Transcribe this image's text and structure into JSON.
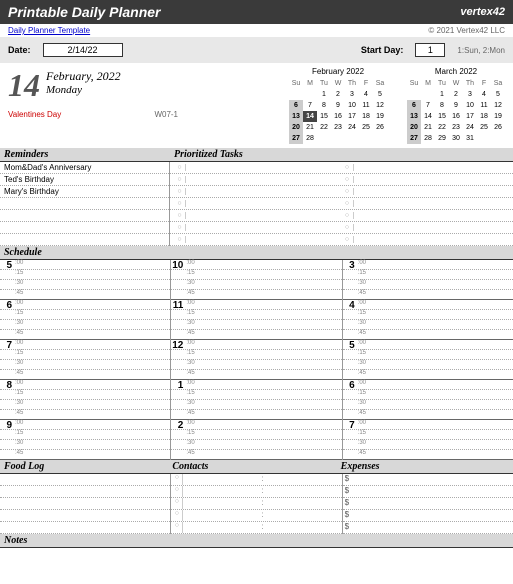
{
  "header": {
    "title": "Printable Daily Planner",
    "brand": "vertex42"
  },
  "subheader": {
    "link": "Daily Planner Template",
    "copyright": "© 2021 Vertex42 LLC"
  },
  "controls": {
    "date_label": "Date:",
    "date_value": "2/14/22",
    "startday_label": "Start Day:",
    "startday_value": "1",
    "startday_hint": "1:Sun, 2:Mon"
  },
  "day": {
    "num": "14",
    "month_year": "February, 2022",
    "weekday": "Monday",
    "holiday": "Valentines Day",
    "week_id": "W07-1"
  },
  "minical1": {
    "title": "February 2022",
    "dow": [
      "Su",
      "M",
      "Tu",
      "W",
      "Th",
      "F",
      "Sa"
    ],
    "weeks": [
      [
        "",
        "",
        "1",
        "2",
        "3",
        "4",
        "5"
      ],
      [
        "6",
        "7",
        "8",
        "9",
        "10",
        "11",
        "12"
      ],
      [
        "13",
        "14",
        "15",
        "16",
        "17",
        "18",
        "19"
      ],
      [
        "20",
        "21",
        "22",
        "23",
        "24",
        "25",
        "26"
      ],
      [
        "27",
        "28",
        "",
        "",
        "",
        "",
        ""
      ]
    ],
    "hl_rows": [
      0,
      1,
      2,
      3,
      4
    ],
    "hl_col": 0,
    "today": [
      2,
      1
    ]
  },
  "minical2": {
    "title": "March 2022",
    "dow": [
      "Su",
      "M",
      "Tu",
      "W",
      "Th",
      "F",
      "Sa"
    ],
    "weeks": [
      [
        "",
        "",
        "1",
        "2",
        "3",
        "4",
        "5"
      ],
      [
        "6",
        "7",
        "8",
        "9",
        "10",
        "11",
        "12"
      ],
      [
        "13",
        "14",
        "15",
        "16",
        "17",
        "18",
        "19"
      ],
      [
        "20",
        "21",
        "22",
        "23",
        "24",
        "25",
        "26"
      ],
      [
        "27",
        "28",
        "29",
        "30",
        "31",
        "",
        ""
      ]
    ],
    "hl_rows": [
      0,
      1,
      2,
      3,
      4
    ],
    "hl_col": 0
  },
  "sections": {
    "reminders": "Reminders",
    "tasks": "Prioritized Tasks",
    "schedule": "Schedule",
    "foodlog": "Food Log",
    "contacts": "Contacts",
    "expenses": "Expenses",
    "notes": "Notes"
  },
  "reminders": [
    "Mom&Dad's Anniversary",
    "Ted's Birthday",
    "Mary's Birthday",
    "",
    "",
    "",
    ""
  ],
  "tasks": [
    [
      "",
      ""
    ],
    [
      "",
      ""
    ],
    [
      "",
      ""
    ],
    [
      "",
      ""
    ],
    [
      "",
      ""
    ],
    [
      "",
      ""
    ],
    [
      "",
      ""
    ]
  ],
  "schedule": {
    "minutes": [
      ":00",
      ":15",
      ":30",
      ":45"
    ],
    "cols": [
      [
        "5",
        "6",
        "7",
        "8",
        "9"
      ],
      [
        "10",
        "11",
        "12",
        "1",
        "2"
      ],
      [
        "3",
        "4",
        "5",
        "6",
        "7"
      ]
    ]
  },
  "foodlog": [
    "",
    "",
    "",
    "",
    ""
  ],
  "contacts": [
    [
      "",
      ""
    ],
    [
      "",
      ""
    ],
    [
      "",
      ""
    ],
    [
      "",
      ""
    ],
    [
      "",
      ""
    ]
  ],
  "expenses": [
    "$",
    "$",
    "$",
    "$",
    "$"
  ]
}
